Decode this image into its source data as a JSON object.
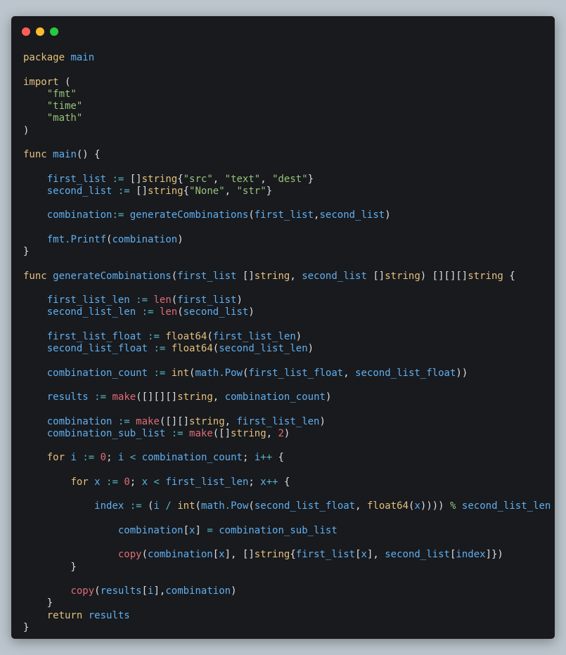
{
  "window": {
    "controls": [
      {
        "name": "close",
        "color": "#ff5f57"
      },
      {
        "name": "minimize",
        "color": "#febc2e"
      },
      {
        "name": "zoom",
        "color": "#28c840"
      }
    ]
  },
  "colors": {
    "background": "#bcc5cd",
    "editor": "#181a1e",
    "keyword": "#e5c07b",
    "identifier": "#61afef",
    "string": "#98c379",
    "builtin": "#e06c75",
    "operator": "#56b6c2",
    "punctuation": "#dcdfe4"
  },
  "code": {
    "lines": [
      [
        [
          "kw",
          "package"
        ],
        [
          "p",
          " "
        ],
        [
          "id",
          "main"
        ]
      ],
      [],
      [
        [
          "kw",
          "import"
        ],
        [
          "p",
          " ("
        ]
      ],
      [
        [
          "p",
          "    "
        ],
        [
          "str",
          "\"fmt\""
        ]
      ],
      [
        [
          "p",
          "    "
        ],
        [
          "str",
          "\"time\""
        ]
      ],
      [
        [
          "p",
          "    "
        ],
        [
          "str",
          "\"math\""
        ]
      ],
      [
        [
          "p",
          ")"
        ]
      ],
      [],
      [
        [
          "kw",
          "func"
        ],
        [
          "p",
          " "
        ],
        [
          "id",
          "main"
        ],
        [
          "p",
          "() {"
        ]
      ],
      [],
      [
        [
          "p",
          "    "
        ],
        [
          "id",
          "first_list"
        ],
        [
          "p",
          " "
        ],
        [
          "op",
          ":="
        ],
        [
          "p",
          " []"
        ],
        [
          "kw",
          "string"
        ],
        [
          "p",
          "{"
        ],
        [
          "str",
          "\"src\""
        ],
        [
          "p",
          ", "
        ],
        [
          "str",
          "\"text\""
        ],
        [
          "p",
          ", "
        ],
        [
          "str",
          "\"dest\""
        ],
        [
          "p",
          "}"
        ]
      ],
      [
        [
          "p",
          "    "
        ],
        [
          "id",
          "second_list"
        ],
        [
          "p",
          " "
        ],
        [
          "op",
          ":="
        ],
        [
          "p",
          " []"
        ],
        [
          "kw",
          "string"
        ],
        [
          "p",
          "{"
        ],
        [
          "str",
          "\"None\""
        ],
        [
          "p",
          ", "
        ],
        [
          "str",
          "\"str\""
        ],
        [
          "p",
          "}"
        ]
      ],
      [],
      [
        [
          "p",
          "    "
        ],
        [
          "id",
          "combination"
        ],
        [
          "op",
          ":="
        ],
        [
          "p",
          " "
        ],
        [
          "id",
          "generateCombinations"
        ],
        [
          "p",
          "("
        ],
        [
          "id",
          "first_list"
        ],
        [
          "p",
          ","
        ],
        [
          "id",
          "second_list"
        ],
        [
          "p",
          ")"
        ]
      ],
      [],
      [
        [
          "p",
          "    "
        ],
        [
          "id",
          "fmt"
        ],
        [
          "op",
          "."
        ],
        [
          "id",
          "Printf"
        ],
        [
          "p",
          "("
        ],
        [
          "id",
          "combination"
        ],
        [
          "p",
          ")"
        ]
      ],
      [
        [
          "p",
          "}"
        ]
      ],
      [],
      [
        [
          "kw",
          "func"
        ],
        [
          "p",
          " "
        ],
        [
          "id",
          "generateCombinations"
        ],
        [
          "p",
          "("
        ],
        [
          "id",
          "first_list"
        ],
        [
          "p",
          " []"
        ],
        [
          "kw",
          "string"
        ],
        [
          "p",
          ", "
        ],
        [
          "id",
          "second_list"
        ],
        [
          "p",
          " []"
        ],
        [
          "kw",
          "string"
        ],
        [
          "p",
          ") [][][]"
        ],
        [
          "kw",
          "string"
        ],
        [
          "p",
          " {"
        ]
      ],
      [],
      [
        [
          "p",
          "    "
        ],
        [
          "id",
          "first_list_len"
        ],
        [
          "p",
          " "
        ],
        [
          "op",
          ":="
        ],
        [
          "p",
          " "
        ],
        [
          "fn",
          "len"
        ],
        [
          "p",
          "("
        ],
        [
          "id",
          "first_list"
        ],
        [
          "p",
          ")"
        ]
      ],
      [
        [
          "p",
          "    "
        ],
        [
          "id",
          "second_list_len"
        ],
        [
          "p",
          " "
        ],
        [
          "op",
          ":="
        ],
        [
          "p",
          " "
        ],
        [
          "fn",
          "len"
        ],
        [
          "p",
          "("
        ],
        [
          "id",
          "second_list"
        ],
        [
          "p",
          ")"
        ]
      ],
      [],
      [
        [
          "p",
          "    "
        ],
        [
          "id",
          "first_list_float"
        ],
        [
          "p",
          " "
        ],
        [
          "op",
          ":="
        ],
        [
          "p",
          " "
        ],
        [
          "kw",
          "float64"
        ],
        [
          "p",
          "("
        ],
        [
          "id",
          "first_list_len"
        ],
        [
          "p",
          ")"
        ]
      ],
      [
        [
          "p",
          "    "
        ],
        [
          "id",
          "second_list_float"
        ],
        [
          "p",
          " "
        ],
        [
          "op",
          ":="
        ],
        [
          "p",
          " "
        ],
        [
          "kw",
          "float64"
        ],
        [
          "p",
          "("
        ],
        [
          "id",
          "second_list_len"
        ],
        [
          "p",
          ")"
        ]
      ],
      [],
      [
        [
          "p",
          "    "
        ],
        [
          "id",
          "combination_count"
        ],
        [
          "p",
          " "
        ],
        [
          "op",
          ":="
        ],
        [
          "p",
          " "
        ],
        [
          "kw",
          "int"
        ],
        [
          "p",
          "("
        ],
        [
          "id",
          "math"
        ],
        [
          "op",
          "."
        ],
        [
          "id",
          "Pow"
        ],
        [
          "p",
          "("
        ],
        [
          "id",
          "first_list_float"
        ],
        [
          "p",
          ", "
        ],
        [
          "id",
          "second_list_float"
        ],
        [
          "p",
          "))"
        ]
      ],
      [],
      [
        [
          "p",
          "    "
        ],
        [
          "id",
          "results"
        ],
        [
          "p",
          " "
        ],
        [
          "op",
          ":="
        ],
        [
          "p",
          " "
        ],
        [
          "fn",
          "make"
        ],
        [
          "p",
          "([][][]"
        ],
        [
          "kw",
          "string"
        ],
        [
          "p",
          ", "
        ],
        [
          "id",
          "combination_count"
        ],
        [
          "p",
          ")"
        ]
      ],
      [],
      [
        [
          "p",
          "    "
        ],
        [
          "id",
          "combination"
        ],
        [
          "p",
          " "
        ],
        [
          "op",
          ":="
        ],
        [
          "p",
          " "
        ],
        [
          "fn",
          "make"
        ],
        [
          "p",
          "([][]"
        ],
        [
          "kw",
          "string"
        ],
        [
          "p",
          ", "
        ],
        [
          "id",
          "first_list_len"
        ],
        [
          "p",
          ")"
        ]
      ],
      [
        [
          "p",
          "    "
        ],
        [
          "id",
          "combination_sub_list"
        ],
        [
          "p",
          " "
        ],
        [
          "op",
          ":="
        ],
        [
          "p",
          " "
        ],
        [
          "fn",
          "make"
        ],
        [
          "p",
          "([]"
        ],
        [
          "kw",
          "string"
        ],
        [
          "p",
          ", "
        ],
        [
          "fn",
          "2"
        ],
        [
          "p",
          ")"
        ]
      ],
      [],
      [
        [
          "p",
          "    "
        ],
        [
          "kw",
          "for"
        ],
        [
          "p",
          " "
        ],
        [
          "id",
          "i"
        ],
        [
          "p",
          " "
        ],
        [
          "op",
          ":="
        ],
        [
          "p",
          " "
        ],
        [
          "fn",
          "0"
        ],
        [
          "p",
          "; "
        ],
        [
          "id",
          "i"
        ],
        [
          "p",
          " "
        ],
        [
          "op",
          "<"
        ],
        [
          "p",
          " "
        ],
        [
          "id",
          "combination_count"
        ],
        [
          "p",
          "; "
        ],
        [
          "id",
          "i"
        ],
        [
          "op",
          "++"
        ],
        [
          "p",
          " {"
        ]
      ],
      [],
      [
        [
          "p",
          "        "
        ],
        [
          "kw",
          "for"
        ],
        [
          "p",
          " "
        ],
        [
          "id",
          "x"
        ],
        [
          "p",
          " "
        ],
        [
          "op",
          ":="
        ],
        [
          "p",
          " "
        ],
        [
          "fn",
          "0"
        ],
        [
          "p",
          "; "
        ],
        [
          "id",
          "x"
        ],
        [
          "p",
          " "
        ],
        [
          "op",
          "<"
        ],
        [
          "p",
          " "
        ],
        [
          "id",
          "first_list_len"
        ],
        [
          "p",
          "; "
        ],
        [
          "id",
          "x"
        ],
        [
          "op",
          "++"
        ],
        [
          "p",
          " {"
        ]
      ],
      [],
      [
        [
          "p",
          "            "
        ],
        [
          "id",
          "index"
        ],
        [
          "p",
          " "
        ],
        [
          "op",
          ":="
        ],
        [
          "p",
          " ("
        ],
        [
          "id",
          "i"
        ],
        [
          "p",
          " "
        ],
        [
          "op",
          "/"
        ],
        [
          "p",
          " "
        ],
        [
          "kw",
          "int"
        ],
        [
          "p",
          "("
        ],
        [
          "id",
          "math"
        ],
        [
          "op",
          "."
        ],
        [
          "id",
          "Pow"
        ],
        [
          "p",
          "("
        ],
        [
          "id",
          "second_list_float"
        ],
        [
          "p",
          ", "
        ],
        [
          "kw",
          "float64"
        ],
        [
          "p",
          "("
        ],
        [
          "id",
          "x"
        ],
        [
          "p",
          "))))"
        ],
        [
          "p",
          " "
        ],
        [
          "str",
          "%"
        ],
        [
          "p",
          " "
        ],
        [
          "id",
          "second_list_len"
        ]
      ],
      [],
      [
        [
          "p",
          "                "
        ],
        [
          "id",
          "combination"
        ],
        [
          "p",
          "["
        ],
        [
          "id",
          "x"
        ],
        [
          "p",
          "] "
        ],
        [
          "op",
          "="
        ],
        [
          "p",
          " "
        ],
        [
          "id",
          "combination_sub_list"
        ]
      ],
      [],
      [
        [
          "p",
          "                "
        ],
        [
          "fn",
          "copy"
        ],
        [
          "p",
          "("
        ],
        [
          "id",
          "combination"
        ],
        [
          "p",
          "["
        ],
        [
          "id",
          "x"
        ],
        [
          "p",
          "], []"
        ],
        [
          "kw",
          "string"
        ],
        [
          "p",
          "{"
        ],
        [
          "id",
          "first_list"
        ],
        [
          "p",
          "["
        ],
        [
          "id",
          "x"
        ],
        [
          "p",
          "], "
        ],
        [
          "id",
          "second_list"
        ],
        [
          "p",
          "["
        ],
        [
          "id",
          "index"
        ],
        [
          "p",
          "]})"
        ]
      ],
      [
        [
          "p",
          "        }"
        ]
      ],
      [],
      [
        [
          "p",
          "        "
        ],
        [
          "fn",
          "copy"
        ],
        [
          "p",
          "("
        ],
        [
          "id",
          "results"
        ],
        [
          "p",
          "["
        ],
        [
          "id",
          "i"
        ],
        [
          "p",
          "],"
        ],
        [
          "id",
          "combination"
        ],
        [
          "p",
          ")"
        ]
      ],
      [
        [
          "p",
          "    }"
        ]
      ],
      [
        [
          "p",
          "    "
        ],
        [
          "kw",
          "return"
        ],
        [
          "p",
          " "
        ],
        [
          "id",
          "results"
        ]
      ],
      [
        [
          "p",
          "}"
        ]
      ]
    ]
  }
}
